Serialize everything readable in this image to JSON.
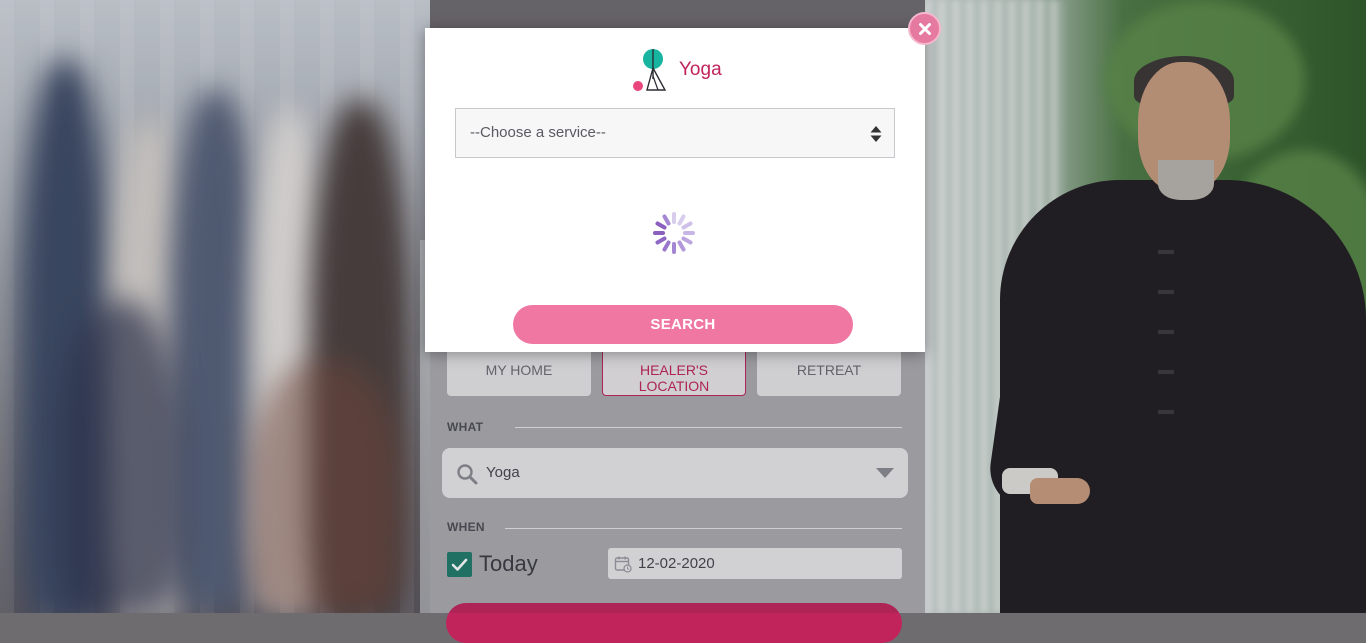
{
  "modal": {
    "title": "Yoga",
    "service_select_placeholder": "--Choose a service--",
    "search_button": "SEARCH"
  },
  "location_options": [
    {
      "label": "MY HOME",
      "active": false
    },
    {
      "label": "HEALER'S LOCATION",
      "active": true
    },
    {
      "label": "RETREAT",
      "active": false
    }
  ],
  "what": {
    "label": "WHAT",
    "value": "Yoga"
  },
  "when": {
    "label": "WHEN",
    "today_label": "Today",
    "today_checked": true,
    "date_value": "12-02-2020"
  },
  "colors": {
    "accent": "#c0245b",
    "button_pink": "#ef77a1",
    "checkbox_teal": "#1f7a6c",
    "logo_teal": "#17b59f",
    "logo_pink": "#e9467d",
    "spinner_purple": "#8b5fbf"
  },
  "icons": {
    "close": "close-icon",
    "logo": "yoga-logo-icon",
    "select_arrows": "up-down-arrows-icon",
    "loading": "loading-spinner-icon",
    "search": "search-icon",
    "caret": "chevron-down-icon",
    "check": "check-icon",
    "calendar": "calendar-icon"
  }
}
